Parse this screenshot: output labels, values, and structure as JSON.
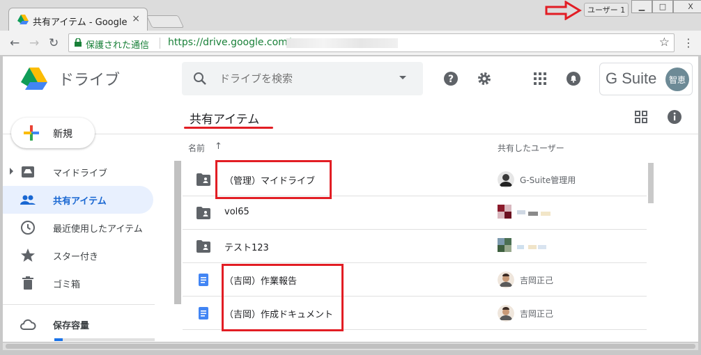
{
  "browser": {
    "tab_title": "共有アイテム - Google",
    "tab_close": "×",
    "profile_label": "ユーザー 1",
    "window_buttons": {
      "minimize": "▁",
      "maximize": "□",
      "close": "X"
    },
    "omnibox": {
      "secure_label": "保護された通信",
      "url": "https://drive.google.com/"
    },
    "nav": {
      "back": "←",
      "forward": "→",
      "reload": "↻",
      "star": "☆",
      "menu": "⋮"
    }
  },
  "header": {
    "app_name": "ドライブ",
    "search_placeholder": "ドライブを検索",
    "gsuite_label": "G Suite",
    "avatar_text": "智恵"
  },
  "new_button_label": "新規",
  "page_title": "共有アイテム",
  "columns": {
    "name": "名前",
    "shared_by": "共有したユーザー"
  },
  "sidebar": {
    "items": [
      {
        "label": "マイドライブ",
        "icon": "drive-icon",
        "active": false
      },
      {
        "label": "共有アイテム",
        "icon": "people-icon",
        "active": true
      },
      {
        "label": "最近使用したアイテム",
        "icon": "clock-icon",
        "active": false
      },
      {
        "label": "スター付き",
        "icon": "star-icon",
        "active": false
      },
      {
        "label": "ゴミ箱",
        "icon": "trash-icon",
        "active": false
      },
      {
        "label": "保存容量",
        "icon": "cloud-icon",
        "active": false
      }
    ]
  },
  "storage_used_fraction": 0.08,
  "files": [
    {
      "name": "（管理）マイドライブ",
      "type": "shared-folder",
      "shared_by": "G-Suite管理用"
    },
    {
      "name": "vol65",
      "type": "shared-folder",
      "shared_by": ""
    },
    {
      "name": "テスト123",
      "type": "shared-folder",
      "shared_by": ""
    },
    {
      "name": "（吉岡）作業報告",
      "type": "doc",
      "shared_by": "吉岡正己"
    },
    {
      "name": "（吉岡）作成ドキュメント",
      "type": "doc",
      "shared_by": "吉岡正己"
    }
  ],
  "colors": {
    "accent": "#1a73e8",
    "active_bg": "#e8f0fe",
    "annotation_red": "#e21d24",
    "doc_blue": "#4285f4",
    "folder_grey": "#5f6368"
  }
}
